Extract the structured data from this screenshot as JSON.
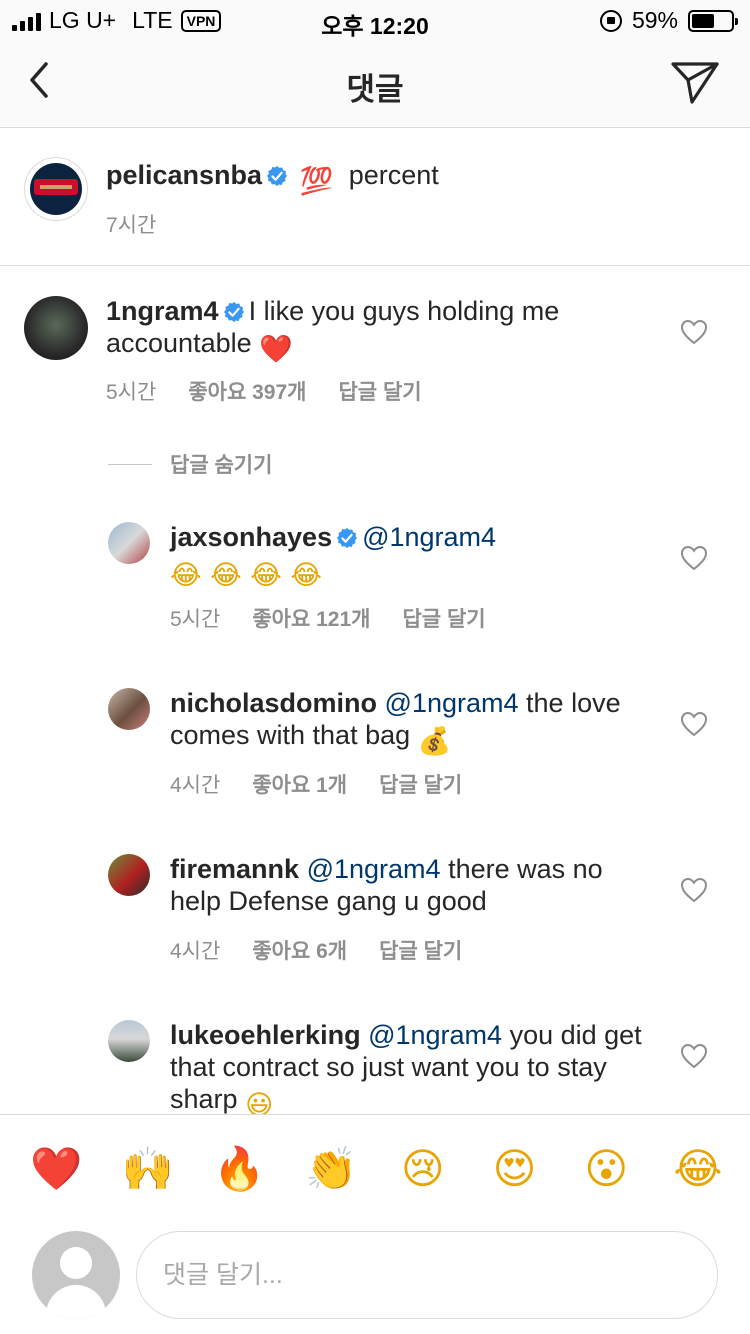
{
  "status_bar": {
    "carrier": "LG U+",
    "network": "LTE",
    "vpn": "VPN",
    "time": "오후 12:20",
    "battery": "59%",
    "battery_level": 0.59
  },
  "nav": {
    "title": "댓글"
  },
  "caption": {
    "username": "pelicansnba",
    "emoji": "💯",
    "text": "percent",
    "time": "7시간"
  },
  "comments": [
    {
      "username": "1ngram4",
      "mention": "",
      "text": "I like you guys holding me accountable",
      "emoji": "❤️",
      "time": "5시간",
      "likes": "좋아요 397개",
      "reply_label": "답글 달기"
    },
    {
      "username": "jaxsonhayes",
      "mention": "@1ngram4",
      "text": "",
      "emoji": "😂 😂 😂 😂",
      "time": "5시간",
      "likes": "좋아요 121개",
      "reply_label": "답글 달기"
    },
    {
      "username": "nicholasdomino",
      "mention": "@1ngram4",
      "text": "the love comes with that bag",
      "emoji": "💰",
      "time": "4시간",
      "likes": "좋아요 1개",
      "reply_label": "답글 달기"
    },
    {
      "username": "firemannk",
      "mention": "@1ngram4",
      "text": "there was no help Defense gang u good",
      "emoji": "",
      "time": "4시간",
      "likes": "좋아요 6개",
      "reply_label": "답글 달기"
    },
    {
      "username": "lukeoehlerking",
      "mention": "@1ngram4",
      "text": "you did get that contract so just want you to stay sharp",
      "emoji": "😃"
    }
  ],
  "hide_replies": "답글 숨기기",
  "emoji_bar": [
    "❤️",
    "🙌",
    "🔥",
    "👏",
    "😢",
    "😍",
    "😮",
    "😂"
  ],
  "composer": {
    "placeholder": "댓글 달기..."
  },
  "colors": {
    "verified": "#3897f0",
    "mention": "#00376b",
    "meta": "#8e8e8e"
  }
}
